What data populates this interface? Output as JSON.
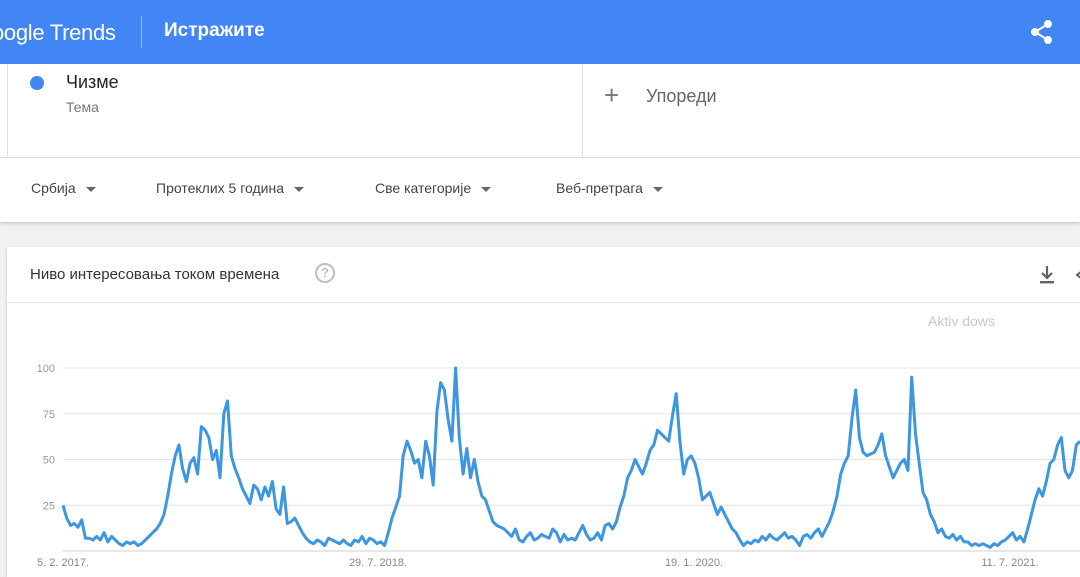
{
  "header": {
    "logo_prefix": "oogle",
    "logo_suffix": "Trends",
    "title": "Истражите",
    "share_icon": "share-icon"
  },
  "term": {
    "name": "Чизме",
    "type": "Тема",
    "color": "#4285f4"
  },
  "compare": {
    "label": "Упореди"
  },
  "filters": [
    {
      "label": "Србија"
    },
    {
      "label": "Протеклих 5 година"
    },
    {
      "label": "Све категорије"
    },
    {
      "label": "Веб-претрага"
    }
  ],
  "card": {
    "title": "Ниво интересовања током времена",
    "help_icon": "?",
    "watermark": "Aktiv                  dows"
  },
  "chart_data": {
    "type": "line",
    "title": "",
    "xlabel": "",
    "ylabel": "",
    "ylim": [
      0,
      100
    ],
    "yticks": [
      25,
      50,
      75,
      100
    ],
    "xtick_labels": [
      "5. 2. 2017.",
      "29. 7. 2018.",
      "19. 1. 2020.",
      "11. 7. 2021."
    ],
    "grid": true,
    "series": [
      {
        "color": "#3c96e0",
        "values": [
          25,
          18,
          14,
          15,
          13,
          17,
          7,
          7,
          6,
          8,
          6,
          10,
          5,
          8,
          6,
          4,
          3,
          5,
          4,
          5,
          3,
          4,
          6,
          8,
          10,
          12,
          15,
          20,
          30,
          42,
          52,
          58,
          45,
          38,
          48,
          51,
          42,
          68,
          66,
          62,
          50,
          55,
          40,
          75,
          82,
          52,
          45,
          40,
          34,
          30,
          26,
          36,
          34,
          28,
          35,
          30,
          38,
          23,
          20,
          35,
          15,
          16,
          18,
          14,
          10,
          7,
          5,
          4,
          6,
          5,
          3,
          7,
          6,
          5,
          4,
          6,
          4,
          3,
          6,
          5,
          8,
          4,
          7,
          6,
          4,
          5,
          3,
          10,
          18,
          24,
          30,
          52,
          60,
          55,
          48,
          50,
          40,
          60,
          52,
          36,
          76,
          92,
          88,
          72,
          60,
          100,
          62,
          42,
          56,
          40,
          50,
          38,
          30,
          28,
          22,
          16,
          14,
          13,
          12,
          10,
          8,
          12,
          6,
          5,
          8,
          10,
          6,
          7,
          9,
          8,
          7,
          12,
          10,
          5,
          9,
          6,
          7,
          6,
          10,
          14,
          9,
          6,
          7,
          10,
          6,
          14,
          15,
          12,
          16,
          24,
          30,
          40,
          44,
          50,
          46,
          42,
          48,
          55,
          58,
          66,
          64,
          62,
          60,
          74,
          86,
          60,
          42,
          50,
          52,
          48,
          40,
          28,
          30,
          32,
          26,
          20,
          24,
          20,
          16,
          12,
          10,
          6,
          3,
          5,
          4,
          6,
          5,
          8,
          6,
          9,
          7,
          6,
          8,
          10,
          7,
          8,
          6,
          3,
          8,
          9,
          7,
          10,
          12,
          8,
          12,
          16,
          22,
          30,
          42,
          48,
          52,
          72,
          88,
          62,
          54,
          52,
          53,
          54,
          58,
          64,
          52,
          46,
          40,
          44,
          48,
          50,
          44,
          95,
          64,
          48,
          32,
          28,
          20,
          16,
          10,
          12,
          8,
          7,
          9,
          6,
          8,
          5,
          5,
          3,
          4,
          3,
          4,
          3,
          2,
          4,
          3,
          5,
          6,
          8,
          10,
          6,
          8,
          5,
          12,
          20,
          28,
          34,
          30,
          38,
          48,
          50,
          58,
          62,
          44,
          40,
          44,
          58,
          60
        ]
      }
    ]
  }
}
